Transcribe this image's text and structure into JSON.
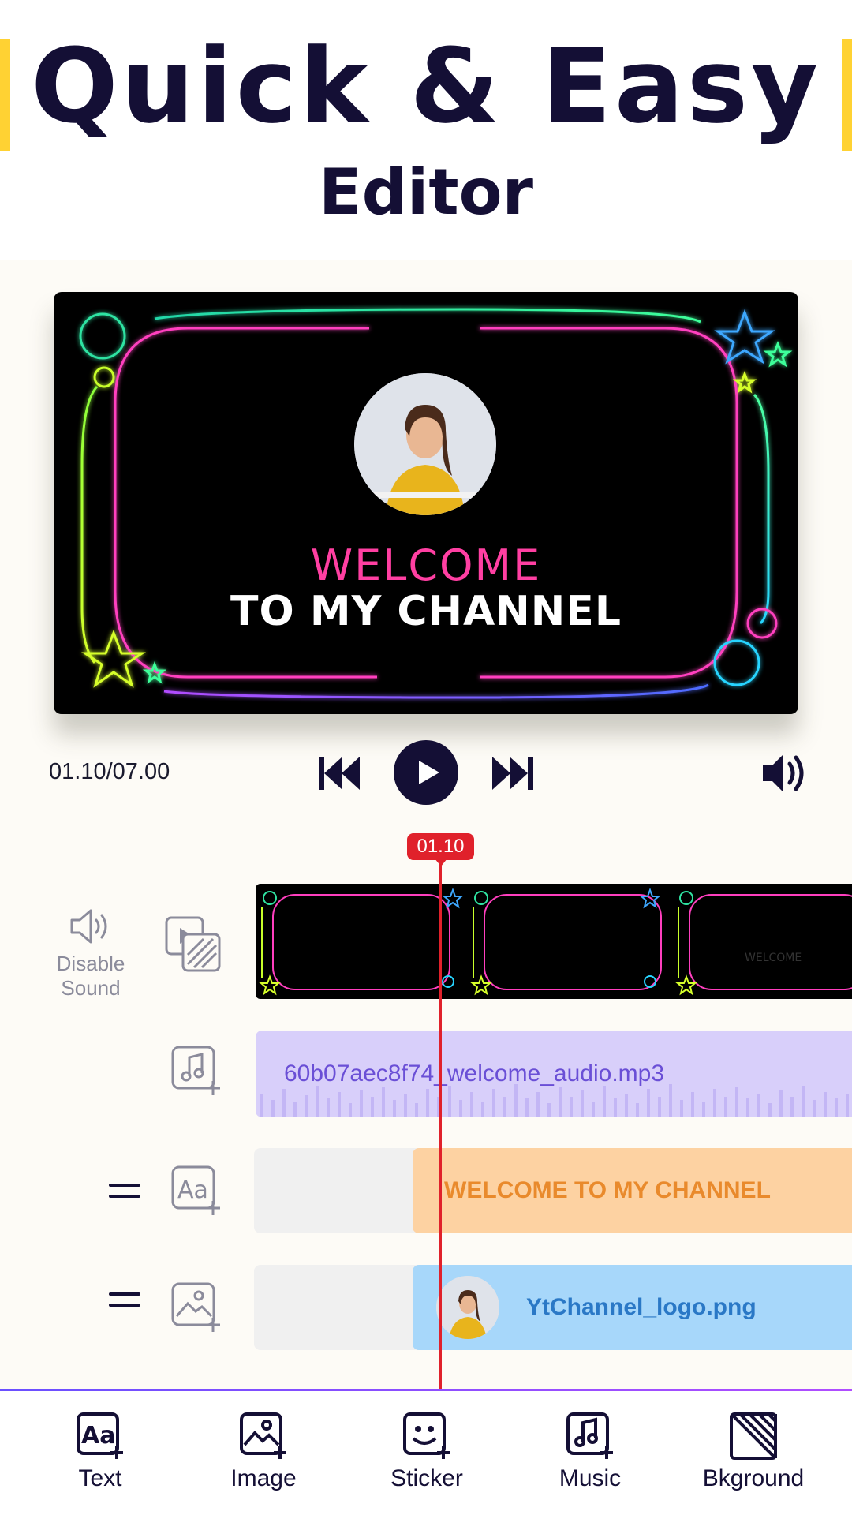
{
  "header": {
    "title": "Quick & Easy",
    "subtitle": "Editor",
    "accent_color": "#ffd233"
  },
  "preview": {
    "welcome_line1": "WELCOME",
    "welcome_line2": "TO MY CHANNEL"
  },
  "player": {
    "time": "01.10/07.00",
    "prev_icon": "skip-previous-icon",
    "play_icon": "play-icon",
    "next_icon": "skip-next-icon",
    "volume_icon": "volume-icon"
  },
  "timeline": {
    "playhead_time": "01.10",
    "disable_sound_label": "Disable\nSound",
    "video_thumb_text": "WELCOME",
    "audio_file": "60b07aec8f74_welcome_audio.mp3",
    "text_clip": "WELCOME TO MY CHANNEL",
    "image_clip": "YtChannel_logo.png"
  },
  "toolbar": {
    "items": [
      {
        "label": "Text",
        "icon": "text-add-icon"
      },
      {
        "label": "Image",
        "icon": "image-add-icon"
      },
      {
        "label": "Sticker",
        "icon": "sticker-add-icon"
      },
      {
        "label": "Music",
        "icon": "music-add-icon"
      },
      {
        "label": "Bkground",
        "icon": "background-icon"
      }
    ]
  }
}
